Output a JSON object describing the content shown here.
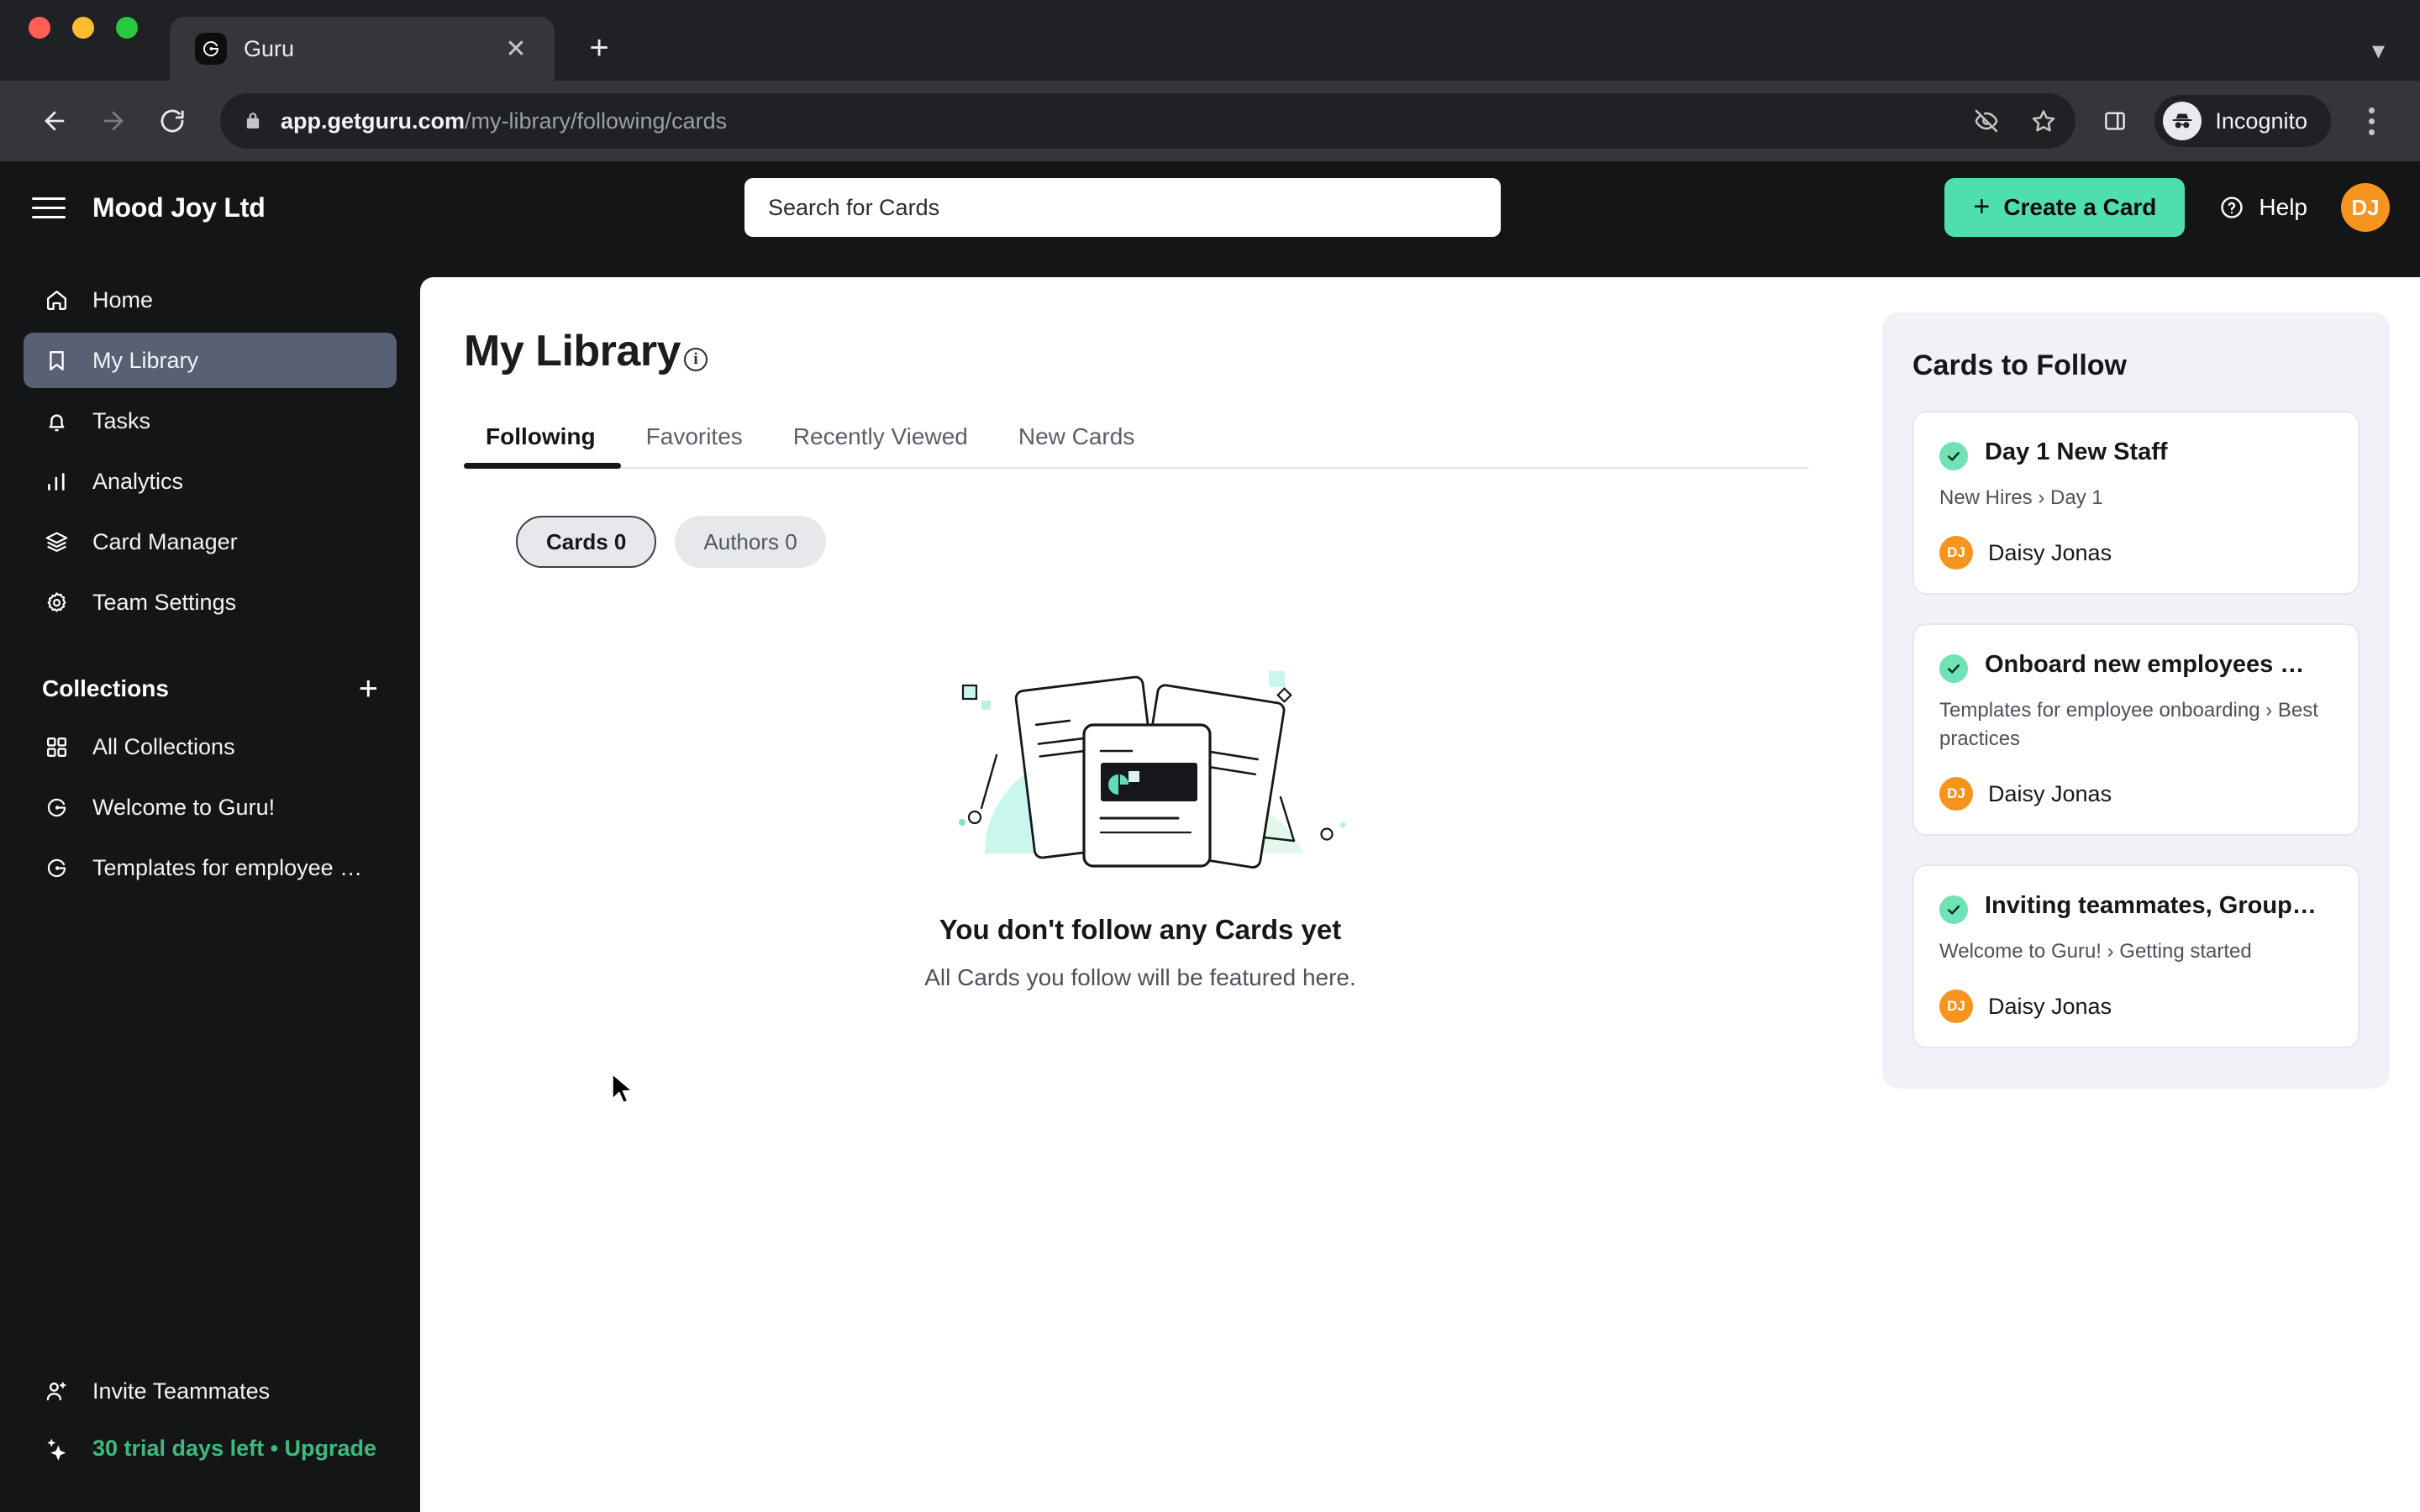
{
  "browser": {
    "tab": {
      "title": "Guru",
      "favicon": "guru-logo-icon",
      "close_icon": "close-icon"
    },
    "new_tab_icon": "plus-icon",
    "tab_list_icon": "chevron-down-icon",
    "nav": {
      "back_icon": "back-arrow-icon",
      "forward_icon": "forward-arrow-icon",
      "reload_icon": "reload-icon"
    },
    "omnibox": {
      "lock_icon": "lock-icon",
      "url_host": "app.getguru.com",
      "url_path": "/my-library/following/cards",
      "tracking_icon": "eye-slash-icon",
      "bookmark_icon": "star-icon"
    },
    "side_panel_icon": "side-panel-icon",
    "profile": {
      "label": "Incognito",
      "icon": "incognito-icon"
    },
    "menu_icon": "kebab-menu-icon"
  },
  "header": {
    "menu_icon": "hamburger-icon",
    "org_name": "Mood Joy Ltd",
    "search_placeholder": "Search for Cards",
    "create_button": "Create a Card",
    "create_icon": "plus-icon",
    "help_label": "Help",
    "help_icon": "question-circle-icon",
    "avatar_initials": "DJ",
    "avatar_color": "#f7941d",
    "accent_color": "#4fdfae"
  },
  "sidebar": {
    "items": [
      {
        "label": "Home",
        "icon": "home-icon",
        "active": false
      },
      {
        "label": "My Library",
        "icon": "bookmark-icon",
        "active": true
      },
      {
        "label": "Tasks",
        "icon": "bell-icon",
        "active": false
      },
      {
        "label": "Analytics",
        "icon": "bar-chart-icon",
        "active": false
      },
      {
        "label": "Card Manager",
        "icon": "layers-icon",
        "active": false
      },
      {
        "label": "Team Settings",
        "icon": "gear-icon",
        "active": false
      }
    ],
    "collections": {
      "title": "Collections",
      "add_icon": "plus-icon",
      "items": [
        {
          "label": "All Collections",
          "icon": "grid-icon"
        },
        {
          "label": "Welcome to Guru!",
          "icon": "guru-logo-icon"
        },
        {
          "label": "Templates for employee …",
          "icon": "guru-logo-icon"
        }
      ]
    },
    "footer": {
      "invite_label": "Invite Teammates",
      "invite_icon": "user-plus-icon",
      "trial_label": "30 trial days left • Upgrade",
      "trial_icon": "sparkles-icon",
      "trial_color": "#3eba7e"
    }
  },
  "main": {
    "page_title": "My Library",
    "info_icon": "info-icon",
    "tabs": [
      {
        "label": "Following",
        "active": true
      },
      {
        "label": "Favorites",
        "active": false
      },
      {
        "label": "Recently Viewed",
        "active": false
      },
      {
        "label": "New Cards",
        "active": false
      }
    ],
    "pills": [
      {
        "label": "Cards 0",
        "selected": true
      },
      {
        "label": "Authors 0",
        "selected": false
      }
    ],
    "empty_state": {
      "illustration": "stacked-cards-illustration",
      "title": "You don't follow any Cards yet",
      "subtitle": "All Cards you follow will be featured here."
    }
  },
  "right_panel": {
    "title": "Cards to Follow",
    "cards": [
      {
        "title": "Day 1 New Staff",
        "path": "New Hires › Day 1",
        "author": "Daisy Jonas",
        "author_initials": "DJ",
        "status_icon": "verified-check-icon"
      },
      {
        "title": "Onboard new employees …",
        "path": "Templates for employee onboarding › Best practices",
        "author": "Daisy Jonas",
        "author_initials": "DJ",
        "status_icon": "verified-check-icon"
      },
      {
        "title": "Inviting teammates, Group…",
        "path": "Welcome to Guru! › Getting started",
        "author": "Daisy Jonas",
        "author_initials": "DJ",
        "status_icon": "verified-check-icon"
      }
    ]
  }
}
